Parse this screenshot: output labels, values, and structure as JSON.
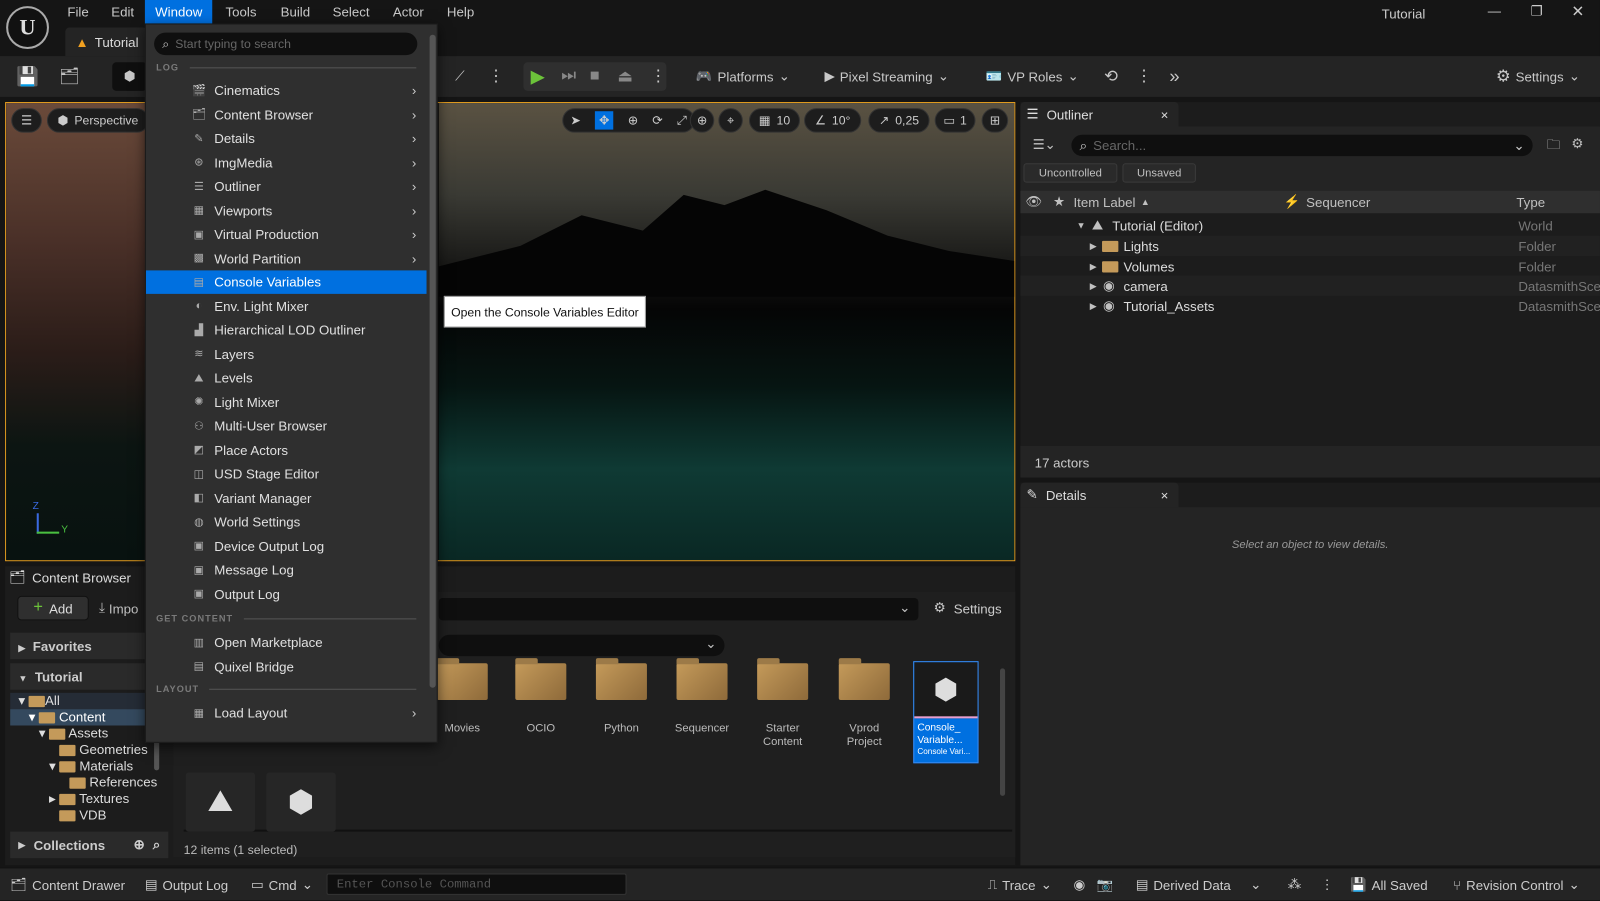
{
  "app": {
    "logo": "U",
    "window_title": "Tutorial",
    "doc_tab": "Tutorial"
  },
  "menubar": [
    "File",
    "Edit",
    "Window",
    "Tools",
    "Build",
    "Select",
    "Actor",
    "Help"
  ],
  "window_menu": {
    "search_placeholder": "Start typing to search",
    "sections": {
      "log": "LOG",
      "get_content": "GET CONTENT",
      "layout": "LAYOUT"
    },
    "log_items": [
      {
        "label": "Cinematics",
        "submenu": true,
        "icon": "clapper-icon"
      },
      {
        "label": "Content Browser",
        "submenu": true,
        "icon": "content-browser-icon"
      },
      {
        "label": "Details",
        "submenu": true,
        "icon": "details-icon"
      },
      {
        "label": "ImgMedia",
        "submenu": true,
        "icon": "film-reel-icon"
      },
      {
        "label": "Outliner",
        "submenu": true,
        "icon": "outliner-icon"
      },
      {
        "label": "Viewports",
        "submenu": true,
        "icon": "viewports-icon"
      },
      {
        "label": "Virtual Production",
        "submenu": true,
        "icon": "virtual-production-icon"
      },
      {
        "label": "World Partition",
        "submenu": true,
        "icon": "world-partition-icon"
      },
      {
        "label": "Console Variables",
        "submenu": false,
        "icon": "console-variables-icon",
        "selected": true
      },
      {
        "label": "Env. Light Mixer",
        "submenu": false,
        "icon": "light-mixer-icon"
      },
      {
        "label": "Hierarchical LOD Outliner",
        "submenu": false,
        "icon": "lod-icon"
      },
      {
        "label": "Layers",
        "submenu": false,
        "icon": "layers-icon"
      },
      {
        "label": "Levels",
        "submenu": false,
        "icon": "levels-icon"
      },
      {
        "label": "Light Mixer",
        "submenu": false,
        "icon": "light-icon"
      },
      {
        "label": "Multi-User Browser",
        "submenu": false,
        "icon": "multi-user-icon"
      },
      {
        "label": "Place Actors",
        "submenu": false,
        "icon": "place-actors-icon"
      },
      {
        "label": "USD Stage Editor",
        "submenu": false,
        "icon": "usd-icon"
      },
      {
        "label": "Variant Manager",
        "submenu": false,
        "icon": "variant-icon"
      },
      {
        "label": "World Settings",
        "submenu": false,
        "icon": "globe-icon"
      },
      {
        "label": "Device Output Log",
        "submenu": false,
        "icon": "log-icon"
      },
      {
        "label": "Message Log",
        "submenu": false,
        "icon": "message-log-icon"
      },
      {
        "label": "Output Log",
        "submenu": false,
        "icon": "output-log-icon"
      }
    ],
    "content_items": [
      {
        "label": "Open Marketplace",
        "icon": "marketplace-icon"
      },
      {
        "label": "Quixel Bridge",
        "icon": "bridge-icon"
      }
    ],
    "layout_items": [
      {
        "label": "Load Layout",
        "submenu": true,
        "icon": "load-layout-icon"
      }
    ]
  },
  "tooltip": "Open the Console Variables Editor",
  "toolbar": {
    "platforms": "Platforms",
    "pixel_streaming": "Pixel Streaming",
    "vp_roles": "VP Roles",
    "settings": "Settings"
  },
  "viewport": {
    "perspective": "Perspective",
    "grid": "10",
    "angle": "10°",
    "scale": "0,25",
    "camera_speed": "1",
    "axis_z": "Z",
    "axis_y": "Y"
  },
  "outliner": {
    "title": "Outliner",
    "search_placeholder": "Search...",
    "filters": [
      "Uncontrolled",
      "Unsaved"
    ],
    "columns": {
      "label": "Item Label",
      "sequencer": "Sequencer",
      "type": "Type"
    },
    "rows": [
      {
        "label": "Tutorial (Editor)",
        "type": "World"
      },
      {
        "label": "Lights",
        "type": "Folder"
      },
      {
        "label": "Volumes",
        "type": "Folder"
      },
      {
        "label": "camera",
        "type": "DatasmithSce"
      },
      {
        "label": "Tutorial_Assets",
        "type": "DatasmithSce"
      }
    ],
    "count": "17 actors"
  },
  "details": {
    "title": "Details",
    "empty": "Select an object to view details."
  },
  "content_browser": {
    "title": "Content Browser",
    "add": "Add",
    "import": "Impo",
    "settings": "Settings",
    "favorites": "Favorites",
    "tutorial": "Tutorial",
    "collections": "Collections",
    "tree": [
      "All",
      "Content",
      "Assets",
      "Geometries",
      "Materials",
      "References",
      "Textures",
      "VDB"
    ],
    "tiles": [
      "Movies",
      "OCIO",
      "Python",
      "Sequencer",
      "Starter Content",
      "Vprod Project"
    ],
    "selected_tile": {
      "name": "Console_ Variable...",
      "type": "Console Vari..."
    },
    "status": "12 items (1 selected)"
  },
  "statusbar": {
    "content_drawer": "Content Drawer",
    "output_log": "Output Log",
    "cmd": "Cmd",
    "console_placeholder": "Enter Console Command",
    "trace": "Trace",
    "derived_data": "Derived Data",
    "all_saved": "All Saved",
    "revision_control": "Revision Control"
  }
}
